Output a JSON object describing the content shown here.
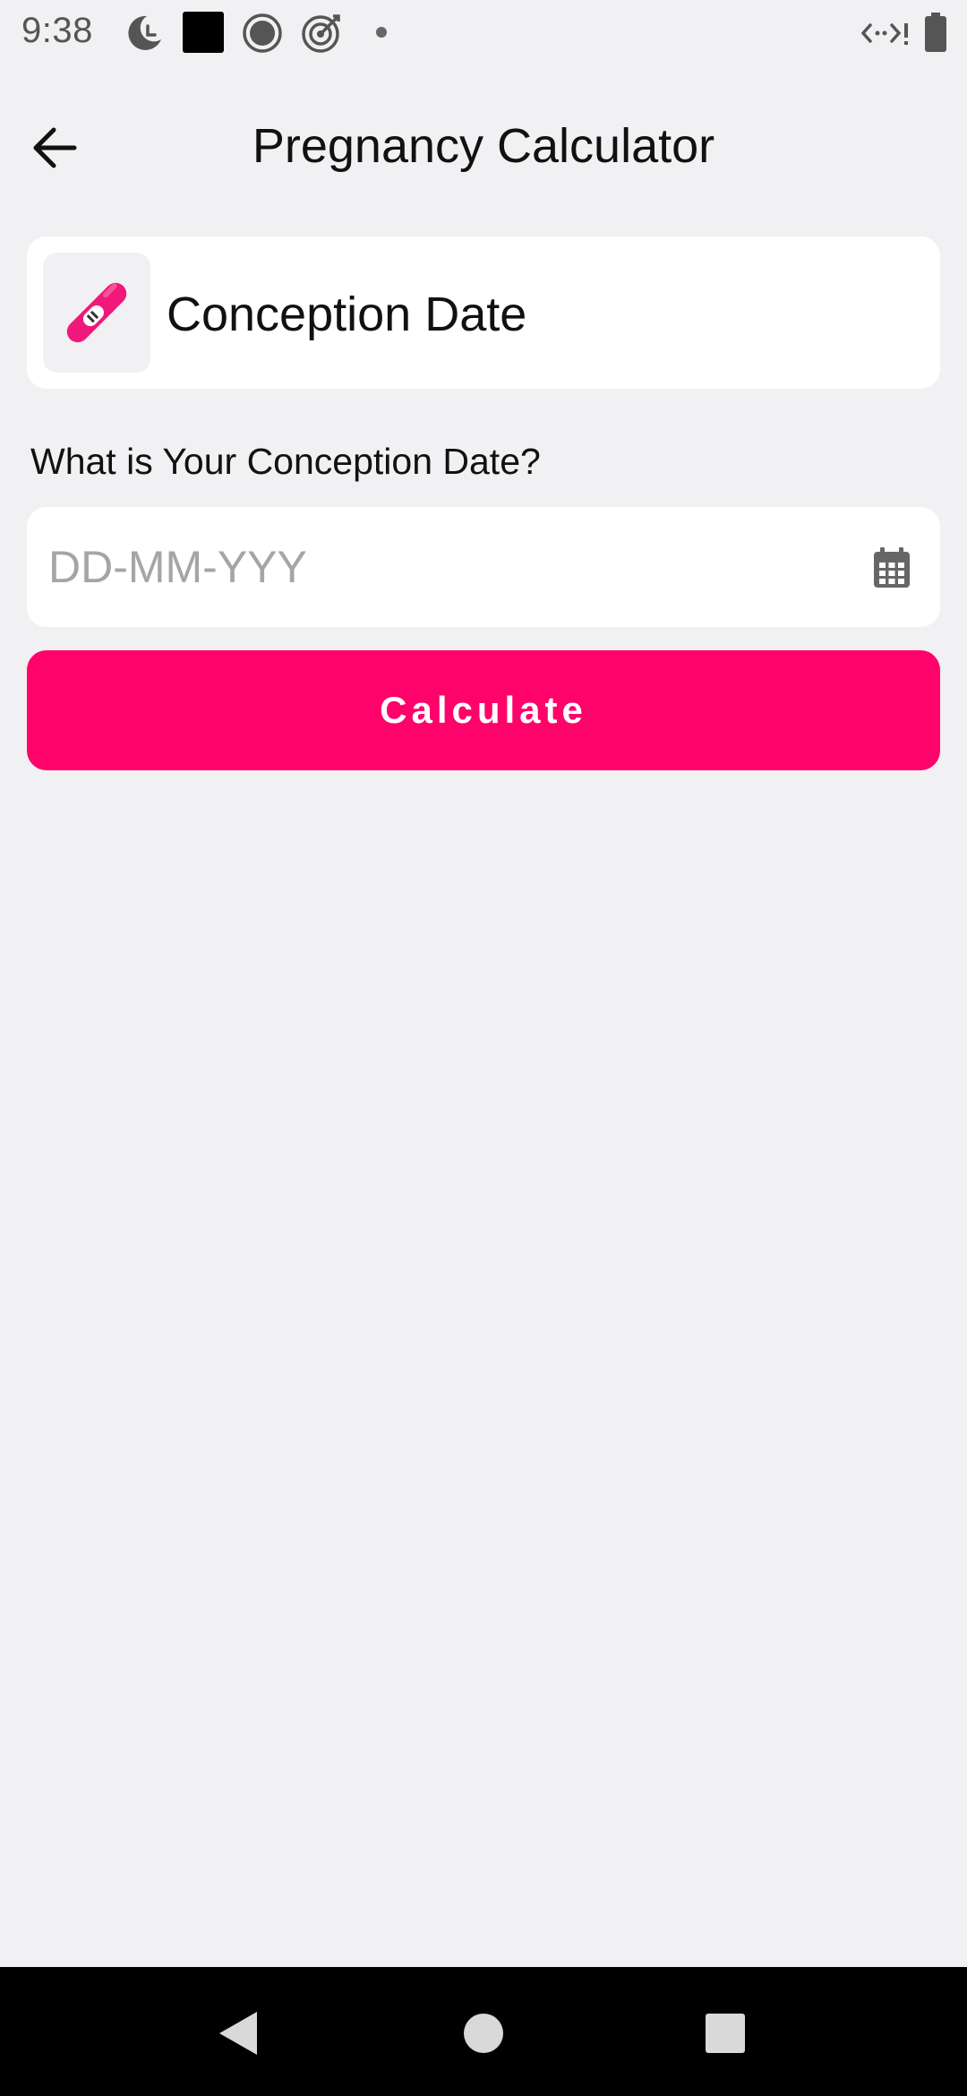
{
  "status_bar": {
    "time": "9:38",
    "icons": [
      "moon-clock-icon",
      "square-icon",
      "record-icon",
      "target-icon",
      "dot-icon",
      "network-icon",
      "battery-icon"
    ]
  },
  "app_bar": {
    "back_icon": "arrow-back-icon",
    "title": "Pregnancy Calculator"
  },
  "method_card": {
    "icon": "pregnancy-test-icon",
    "title": "Conception Date"
  },
  "form": {
    "question": "What is Your Conception Date?",
    "date_input": {
      "value": "",
      "placeholder": "DD-MM-YYY",
      "icon": "calendar-icon"
    },
    "calculate_label": "Calculate"
  },
  "nav_bar": {
    "buttons": [
      "nav-back-icon",
      "nav-home-icon",
      "nav-recents-icon"
    ]
  },
  "colors": {
    "background": "#F1F0F2",
    "card": "#FFFFFF",
    "accent": "#FE036A",
    "placeholder": "#A5A5A5",
    "nav_bar": "#000000"
  }
}
